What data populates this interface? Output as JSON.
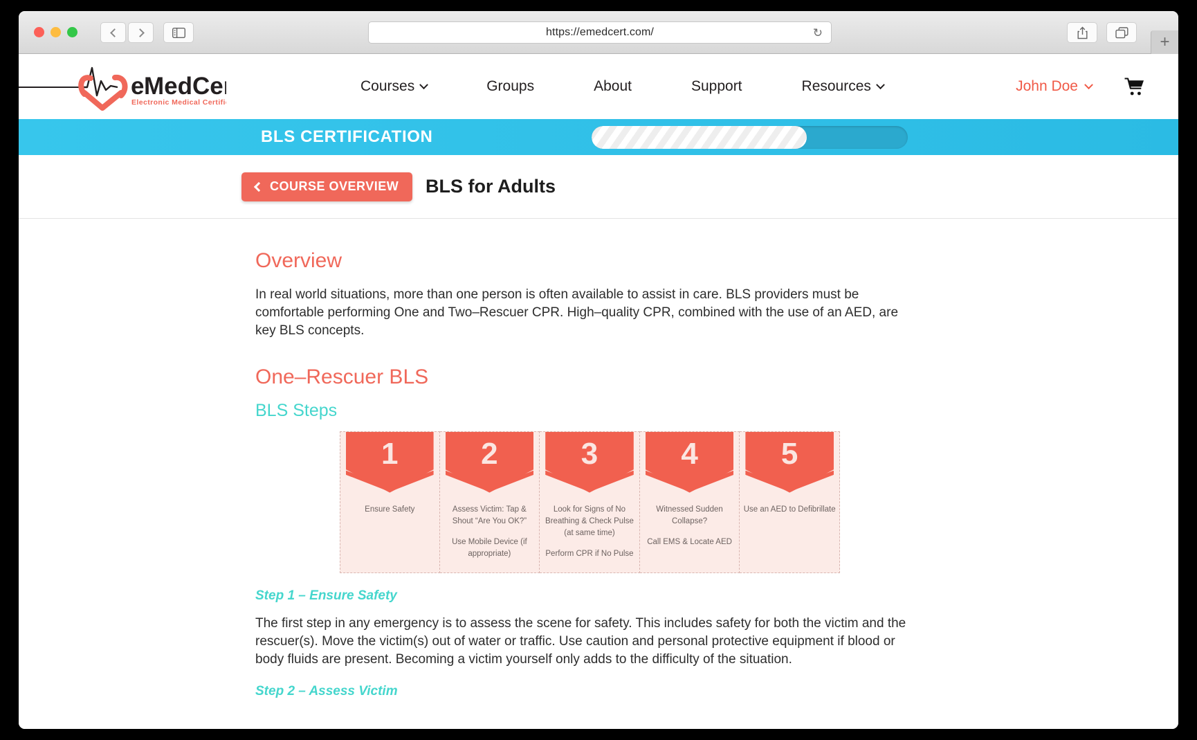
{
  "browser": {
    "url": "https://emedcert.com/",
    "reload_icon": "reload-icon",
    "back_icon": "chevron-left-icon",
    "forward_icon": "chevron-right-icon",
    "sidebar_icon": "sidebar-panel-icon",
    "share_icon": "share-upload-icon",
    "tabs_icon": "tab-overview-icon",
    "new_tab_label": "+"
  },
  "site_header": {
    "logo": {
      "name": "eMedCert",
      "name_part1": "e",
      "name_part2": "MedCert",
      "tagline": "Electronic Medical Certification"
    },
    "nav": [
      {
        "label": "Courses",
        "has_caret": true
      },
      {
        "label": "Groups",
        "has_caret": false
      },
      {
        "label": "About",
        "has_caret": false
      },
      {
        "label": "Support",
        "has_caret": false
      },
      {
        "label": "Resources",
        "has_caret": true
      }
    ],
    "user": {
      "label": "John Doe",
      "has_caret": true
    },
    "cart_icon": "shopping-cart-icon"
  },
  "cert_bar": {
    "title": "BLS CERTIFICATION",
    "progress_percent": 68
  },
  "course_header": {
    "overview_button": "COURSE OVERVIEW",
    "back_icon": "chevron-left-icon",
    "title": "BLS for Adults"
  },
  "lesson": {
    "overview_heading": "Overview",
    "overview_text": "In real world situations, more than one person is often available to assist in care. BLS providers must be comfortable performing One and Two–Rescuer CPR. High–quality CPR, combined with the use of an AED, are key BLS concepts.",
    "section_heading": "One–Rescuer BLS",
    "sub_heading": "BLS Steps",
    "steps": [
      {
        "number": "1",
        "line1": "Ensure Safety",
        "line2": ""
      },
      {
        "number": "2",
        "line1": "Assess Victim: Tap & Shout “Are You OK?”",
        "line2": "Use Mobile Device (if appropriate)"
      },
      {
        "number": "3",
        "line1": "Look for Signs of No Breathing & Check Pulse (at same time)",
        "line2": "Perform CPR if No Pulse"
      },
      {
        "number": "4",
        "line1": "Witnessed Sudden Collapse?",
        "line2": "Call EMS & Locate AED"
      },
      {
        "number": "5",
        "line1": "Use an AED to Defibrillate",
        "line2": ""
      }
    ],
    "step1_heading": "Step 1 – Ensure Safety",
    "step1_text": "The first step in any emergency is to assess the scene for safety. This includes safety for both the victim and the rescuer(s). Move the victim(s) out of water or traffic. Use caution and personal protective equipment if blood or body fluids are present. Becoming a victim yourself only adds to the difficulty of the situation.",
    "step2_heading": "Step 2 – Assess Victim"
  },
  "colors": {
    "accent_coral": "#f0685a",
    "accent_teal": "#45d6cd",
    "cert_blue": "#2bbbe4",
    "step_fill": "#fcebe7",
    "step_chevron": "#f1604f"
  }
}
